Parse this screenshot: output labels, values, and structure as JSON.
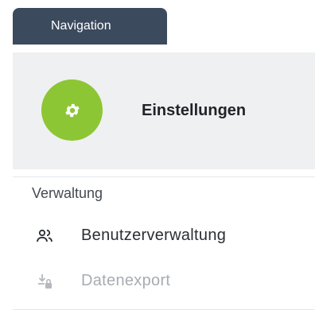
{
  "nav_tab": {
    "label": "Navigation"
  },
  "header": {
    "title": "Einstellungen",
    "avatar_icon": "gear-icon",
    "avatar_color": "#8dc635"
  },
  "section": {
    "label": "Verwaltung",
    "items": [
      {
        "label": "Benutzerverwaltung",
        "icon": "users-icon",
        "enabled": true
      },
      {
        "label": "Datenexport",
        "icon": "download-lock-icon",
        "enabled": false
      }
    ]
  },
  "colors": {
    "tab_background": "#3c4a5e",
    "header_background": "#eff0f1",
    "accent": "#8dc635",
    "disabled_text": "#a8acb0"
  }
}
